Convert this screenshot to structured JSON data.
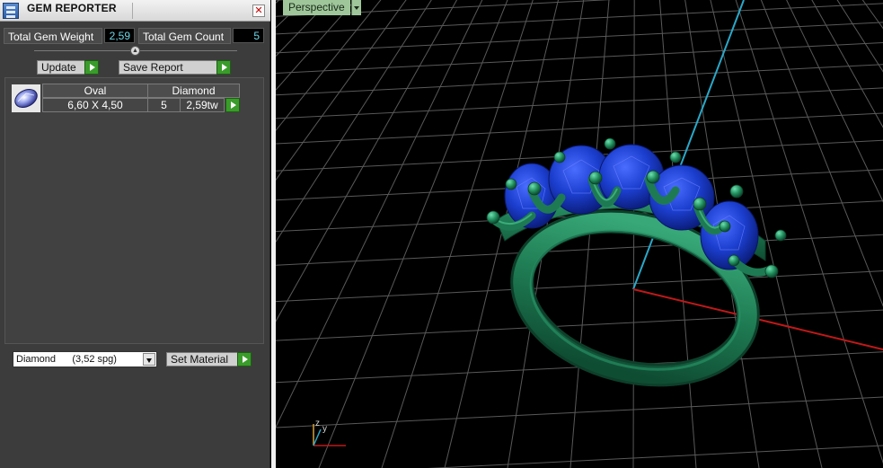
{
  "panel": {
    "title": "GEM REPORTER",
    "close_glyph": "✕",
    "total_weight_label": "Total Gem Weight",
    "total_weight_value": "2,59",
    "total_count_label": "Total Gem Count",
    "total_count_value": "5",
    "update_label": "Update",
    "save_report_label": "Save Report",
    "set_material_label": "Set Material",
    "material_selected": "Diamond      (3,52 spg)",
    "icons": {
      "app": "gem-reporter-icon",
      "collapse": "collapse-up-icon",
      "gem": "oval-gem-icon"
    }
  },
  "report": {
    "rows": [
      {
        "shape": "Oval",
        "material": "Diamond",
        "size": "6,60 X 4,50",
        "count": "5",
        "weight": "2,59tw"
      }
    ]
  },
  "viewport": {
    "label": "Perspective",
    "axis_z": "z",
    "axis_y": "y",
    "colors": {
      "background": "#000000",
      "grid": "#5a5a5a",
      "x_axis": "#c01818",
      "y_axis": "#2aa8c8",
      "metal": "#1e7a52",
      "gem": "#1c3fd0"
    }
  }
}
